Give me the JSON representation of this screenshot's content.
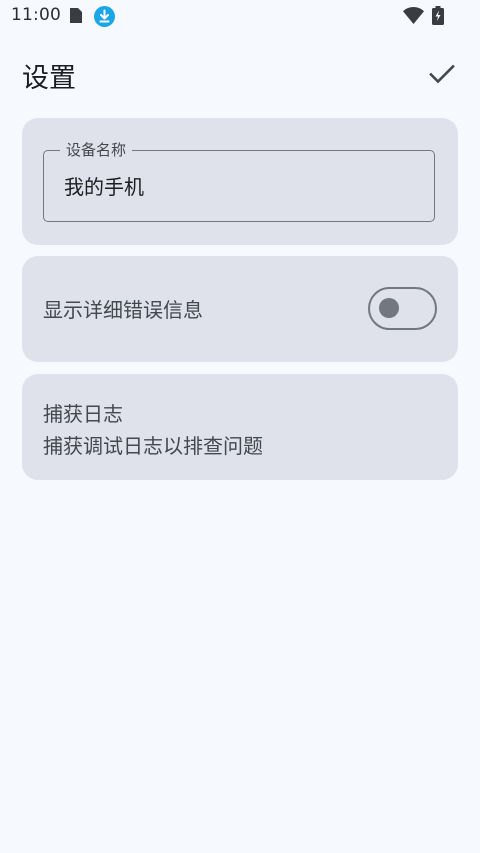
{
  "status_bar": {
    "time": "11:00",
    "icons": [
      "sim-card-icon",
      "download-icon",
      "wifi-icon",
      "battery-charging-icon"
    ],
    "download_color": "#1ba6e8"
  },
  "app_bar": {
    "title": "设置",
    "confirm_icon": "check-icon"
  },
  "device_name_field": {
    "label": "设备名称",
    "value": "我的手机"
  },
  "detailed_errors": {
    "label": "显示详细错误信息",
    "enabled": false
  },
  "capture_logs": {
    "title": "捕获日志",
    "description": "捕获调试日志以排查问题"
  },
  "colors": {
    "background": "#f6f9fe",
    "card": "#dfe2eb",
    "outline": "#73777f",
    "text": "#1b1d21"
  }
}
